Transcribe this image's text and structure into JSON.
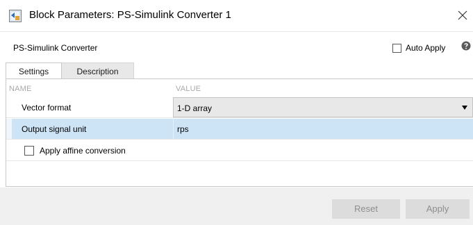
{
  "window": {
    "title": "Block Parameters: PS-Simulink Converter 1",
    "icon": "simulink-block-icon",
    "close_icon": "close-icon"
  },
  "header": {
    "block_name": "PS-Simulink Converter",
    "auto_apply_label": "Auto Apply",
    "auto_apply_checked": false,
    "help_icon": "help-icon"
  },
  "tabs": [
    {
      "label": "Settings",
      "active": true
    },
    {
      "label": "Description",
      "active": false
    }
  ],
  "table": {
    "col_name": "NAME",
    "col_value": "VALUE",
    "rows": [
      {
        "label": "Vector format",
        "value": "1-D array",
        "type": "dropdown"
      },
      {
        "label": "Output signal unit",
        "value": "rps",
        "type": "text",
        "selected": true
      }
    ],
    "affine": {
      "label": "Apply affine conversion",
      "checked": false
    }
  },
  "footer": {
    "reset_label": "Reset",
    "apply_label": "Apply"
  },
  "colors": {
    "selected_row": "#cde4f7",
    "dropdown_bg": "#e8e8e8",
    "footer_bg": "#f0f0f0",
    "disabled_button_bg": "#dcdcdc",
    "disabled_button_text": "#8e8e8e"
  }
}
